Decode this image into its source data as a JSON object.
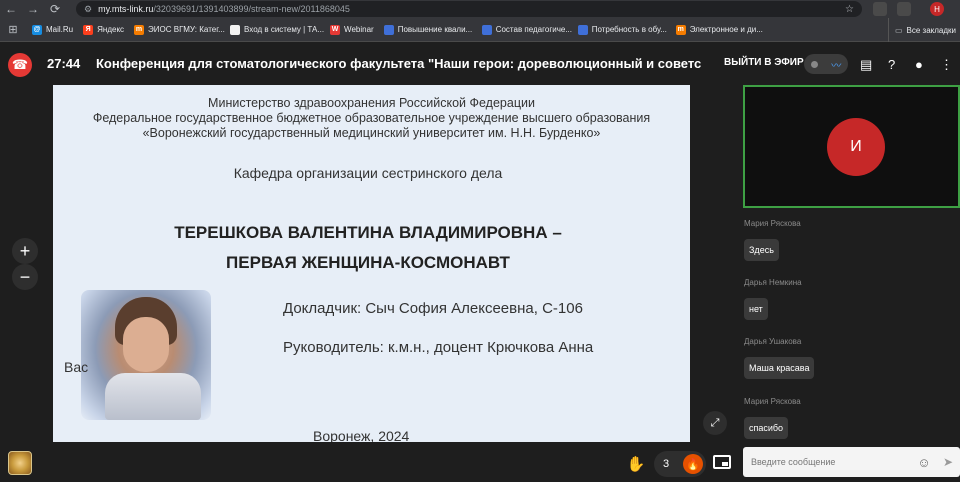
{
  "browser": {
    "url_host": "my.mts-link.ru",
    "url_path": "/32039691/1391403899/stream-new/2011868045",
    "profile_initial": "Н",
    "bookmarks": [
      {
        "label": "Mail.Ru",
        "icon": "mailru-icon",
        "color": "#168de2"
      },
      {
        "label": "Яндекс",
        "icon": "yandex-icon",
        "color": "#fc3f1d"
      },
      {
        "label": "ЭИОС ВГМУ: Катег...",
        "icon": "eios-icon",
        "color": "#f57c00"
      },
      {
        "label": "Вход в систему | ТА...",
        "icon": "ta-icon",
        "color": "#f2f2f2"
      },
      {
        "label": "Webinar",
        "icon": "webinar-icon",
        "color": "#e53935"
      },
      {
        "label": "Повышение квали...",
        "icon": "doc-icon",
        "color": "#3f6fd8"
      },
      {
        "label": "Состав педагогиче...",
        "icon": "doc-icon",
        "color": "#3f6fd8"
      },
      {
        "label": "Потребность в обу...",
        "icon": "doc-icon",
        "color": "#3f6fd8"
      },
      {
        "label": "Электронное и ди...",
        "icon": "eios-icon",
        "color": "#f57c00"
      }
    ],
    "all_bookmarks": "Все закладки"
  },
  "header": {
    "timer": "27:44",
    "title": "Конференция для стоматологического факультета \"Наши герои: дореволюционный и советский пе",
    "go_live": "ВЫЙТИ В ЭФИР"
  },
  "slide": {
    "ministry": [
      "Министерство здравоохранения Российской Федерации",
      "Федеральное государственное бюджетное образовательное учреждение высшего образования",
      "«Воронежский государственный медицинский университет им. Н.Н. Бурденко»"
    ],
    "department": "Кафедра организации сестринского дела",
    "title_line1": "ТЕРЕШКОВА ВАЛЕНТИНА ВЛАДИМИРОВНА –",
    "title_line2": "ПЕРВАЯ ЖЕНЩИНА-КОСМОНАВТ",
    "partial_text": "Вас",
    "speaker": "Докладчик: Сыч София Алексеевна, С-106",
    "supervisor": "Руководитель: к.м.н., доцент Крючкова Анна",
    "city_year": "Воронеж, 2024"
  },
  "controls": {
    "zoom_in": "+",
    "zoom_out": "−",
    "reaction_count": "3"
  },
  "participant": {
    "avatar_letter": "И"
  },
  "chat": {
    "messages": [
      {
        "author": "Мария Ряскова",
        "text": "Здесь"
      },
      {
        "author": "Дарья Немкина",
        "text": "нет"
      },
      {
        "author": "Дарья Ушакова",
        "text": "Маша красава"
      },
      {
        "author": "Мария Ряскова",
        "text": "спасибо"
      }
    ],
    "placeholder": "Введите сообщение"
  }
}
